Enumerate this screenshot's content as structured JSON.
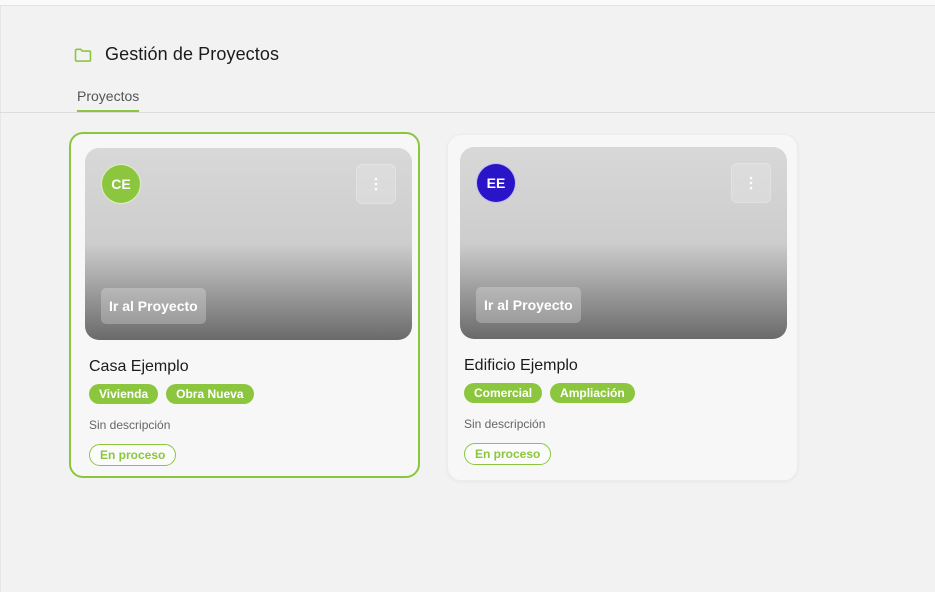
{
  "header": {
    "title": "Gestión de Proyectos",
    "icon": "folder-icon"
  },
  "tabs": [
    {
      "label": "Proyectos",
      "active": true
    }
  ],
  "colors": {
    "accent": "#8cc63f",
    "avatar_ce": "#8cc63f",
    "avatar_ee": "#2a14c8"
  },
  "projects": [
    {
      "initials": "CE",
      "action_label": "Ir al Proyecto",
      "name": "Casa Ejemplo",
      "tags": [
        "Vivienda",
        "Obra Nueva"
      ],
      "description": "Sin descripción",
      "status": "En proceso",
      "selected": true
    },
    {
      "initials": "EE",
      "action_label": "Ir al Proyecto",
      "name": "Edificio Ejemplo",
      "tags": [
        "Comercial",
        "Ampliación"
      ],
      "description": "Sin descripción",
      "status": "En proceso",
      "selected": false
    }
  ]
}
